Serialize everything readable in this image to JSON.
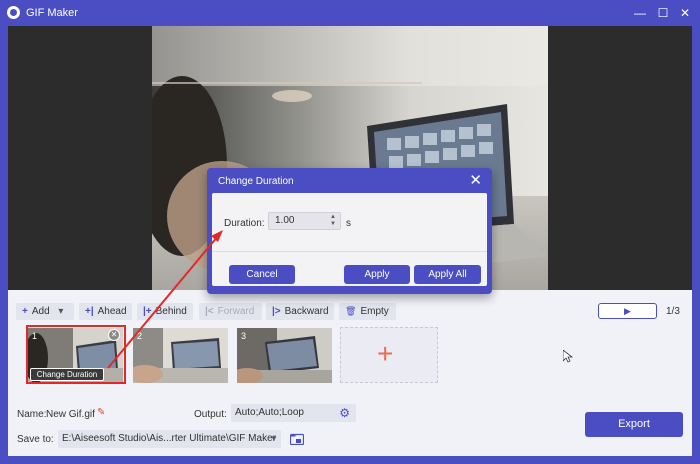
{
  "window": {
    "title": "GIF Maker",
    "controls": {
      "minimize": "—",
      "maximize": "☐",
      "close": "✕"
    }
  },
  "dialog": {
    "title": "Change Duration",
    "close": "✕",
    "duration_label": "Duration:",
    "duration_value": "1.00",
    "spin_up": "▲",
    "spin_down": "▼",
    "unit": "s",
    "cancel_label": "Cancel",
    "apply_label": "Apply",
    "apply_all_label": "Apply All"
  },
  "toolbar": {
    "add": {
      "icon": "+",
      "label": "Add",
      "dropdown": "▾"
    },
    "ahead": {
      "icon": "+|",
      "label": "Ahead"
    },
    "behind": {
      "icon": "|+",
      "label": "Behind"
    },
    "forward": {
      "icon": "|<",
      "label": "Forward"
    },
    "backward": {
      "icon": "|>",
      "label": "Backward"
    },
    "empty": {
      "icon": "🗑",
      "label": "Empty"
    },
    "play": "▶",
    "page_counter": "1/3"
  },
  "frames": {
    "items": [
      {
        "index": "1"
      },
      {
        "index": "2"
      },
      {
        "index": "3"
      }
    ],
    "tooltip": "Change Duration",
    "close": "✕",
    "add_slot": "+"
  },
  "bottom": {
    "name_label": "Name:",
    "name_value": "New Gif.gif",
    "edit_icon": "✎",
    "output_label": "Output:",
    "output_value": "Auto;Auto;Loop",
    "gear_icon": "⚙",
    "save_label": "Save to:",
    "save_value": "E:\\Aiseesoft Studio\\Ais...rter Ultimate\\GIF Maker",
    "save_dropdown": "▼",
    "export_label": "Export"
  },
  "colors": {
    "accent": "#4a4ec2",
    "annotation": "#e02a2a",
    "add_plus": "#ef6b4c"
  }
}
